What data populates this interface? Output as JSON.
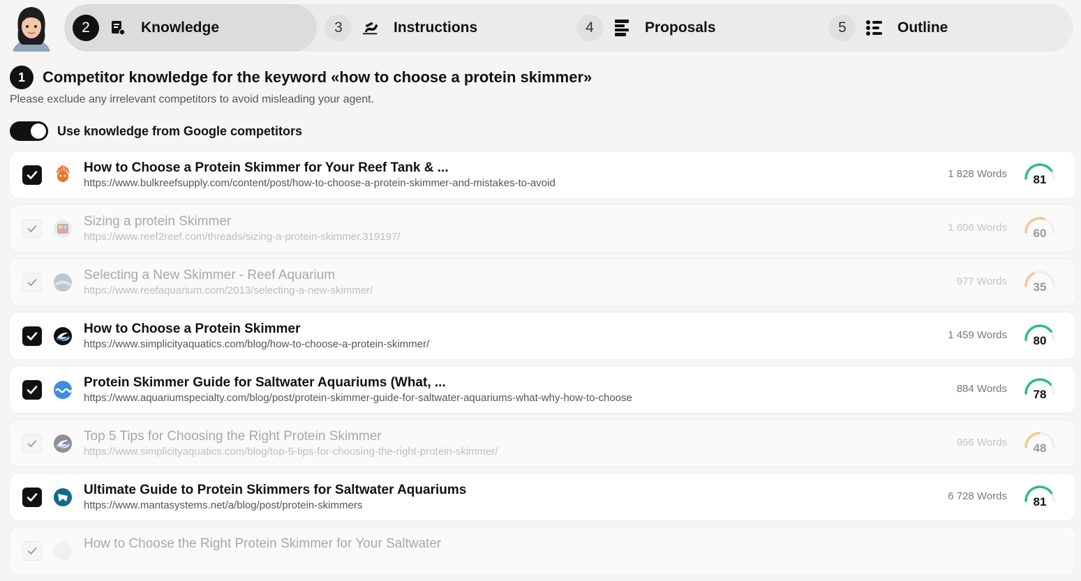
{
  "steps": [
    {
      "num": "2",
      "label": "Knowledge",
      "icon": "book-icon",
      "active": true
    },
    {
      "num": "3",
      "label": "Instructions",
      "icon": "pen-writing-icon",
      "active": false
    },
    {
      "num": "4",
      "label": "Proposals",
      "icon": "list-bars-icon",
      "active": false
    },
    {
      "num": "5",
      "label": "Outline",
      "icon": "bullet-list-icon",
      "active": false
    }
  ],
  "section": {
    "number": "1",
    "title": "Competitor knowledge for the keyword «how to choose a protein skimmer»",
    "subtitle": "Please exclude any irrelevant competitors to avoid misleading your agent."
  },
  "toggle": {
    "label": "Use knowledge from Google competitors",
    "on": true
  },
  "colors": {
    "score_high": "#2bbf7a",
    "score_mid": "#f5c790",
    "track": "#eeeeee",
    "accent": "#111111"
  },
  "competitors": [
    {
      "title": "How to Choose a Protein Skimmer for Your Reef Tank & ...",
      "url": "https://www.bulkreefsupply.com/content/post/how-to-choose-a-protein-skimmer-and-mistakes-to-avoid",
      "words": "1 828 Words",
      "score": 81,
      "checked": true,
      "icon": "bulk-reef-supply-logo-icon"
    },
    {
      "title": "Sizing a protein Skimmer",
      "url": "https://www.reef2reef.com/threads/sizing-a-protein-skimmer.319197/",
      "words": "1 606 Words",
      "score": 60,
      "checked": false,
      "icon": "reef2reef-logo-icon"
    },
    {
      "title": "Selecting a New Skimmer - Reef Aquarium",
      "url": "https://www.reefaquarium.com/2013/selecting-a-new-skimmer/",
      "words": "977 Words",
      "score": 35,
      "checked": false,
      "icon": "reef-aquarium-logo-icon"
    },
    {
      "title": "How to Choose a Protein Skimmer",
      "url": "https://www.simplicityaquatics.com/blog/how-to-choose-a-protein-skimmer/",
      "words": "1 459 Words",
      "score": 80,
      "checked": true,
      "icon": "simplicity-aquatics-logo-icon"
    },
    {
      "title": "Protein Skimmer Guide for Saltwater Aquariums (What, ...",
      "url": "https://www.aquariumspecialty.com/blog/post/protein-skimmer-guide-for-saltwater-aquariums-what-why-how-to-choose",
      "words": "884 Words",
      "score": 78,
      "checked": true,
      "icon": "aquarium-specialty-logo-icon"
    },
    {
      "title": "Top 5 Tips for Choosing the Right Protein Skimmer",
      "url": "https://www.simplicityaquatics.com/blog/top-5-tips-for-choosing-the-right-protein-skimmer/",
      "words": "956 Words",
      "score": 48,
      "checked": false,
      "icon": "simplicity-aquatics-logo-icon"
    },
    {
      "title": "Ultimate Guide to Protein Skimmers for Saltwater Aquariums",
      "url": "https://www.mantasystems.net/a/blog/post/protein-skimmers",
      "words": "6 728 Words",
      "score": 81,
      "checked": true,
      "icon": "manta-systems-logo-icon"
    },
    {
      "title": "How to Choose the Right Protein Skimmer for Your Saltwater",
      "url": "",
      "words": "",
      "score": null,
      "checked": false,
      "icon": "site-logo-icon"
    }
  ]
}
